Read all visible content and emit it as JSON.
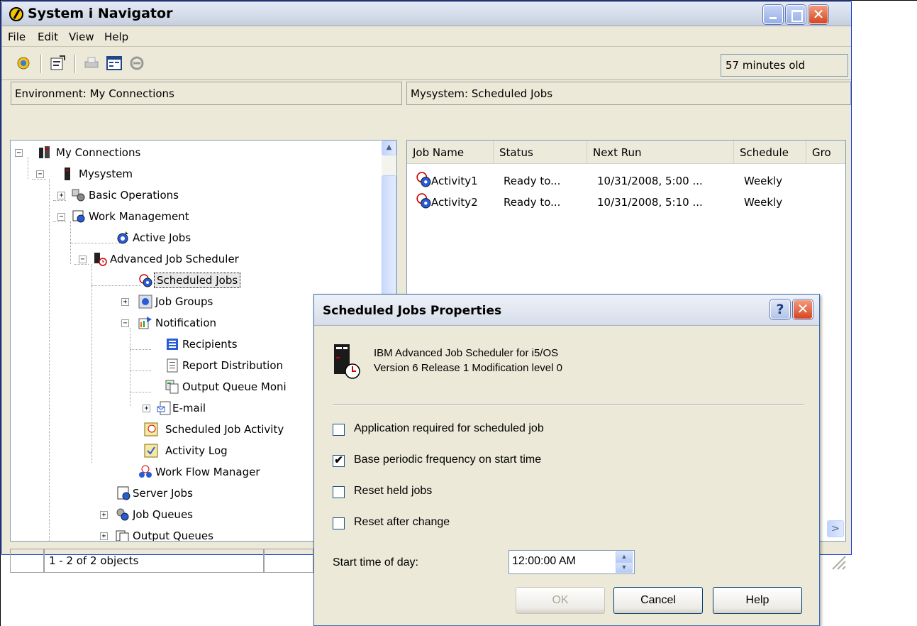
{
  "window": {
    "title": "System i Navigator",
    "menu": [
      "File",
      "Edit",
      "View",
      "Help"
    ],
    "age_label": "57 minutes old",
    "left_header": "Environment: My Connections",
    "right_header": "Mysystem:  Scheduled Jobs",
    "status": "1 - 2 of 2 objects"
  },
  "tree": [
    {
      "label": "My Connections",
      "icon": "connections-icon"
    },
    {
      "label": "Mysystem",
      "icon": "system-icon"
    },
    {
      "label": "Basic Operations",
      "icon": "basic-operations-icon"
    },
    {
      "label": "Work Management",
      "icon": "work-management-icon"
    },
    {
      "label": "Active Jobs",
      "icon": "active-jobs-icon"
    },
    {
      "label": "Advanced Job Scheduler",
      "icon": "job-scheduler-icon"
    },
    {
      "label": "Scheduled Jobs",
      "icon": "scheduled-jobs-icon",
      "selected": true
    },
    {
      "label": "Job Groups",
      "icon": "job-groups-icon"
    },
    {
      "label": "Notification",
      "icon": "notification-icon"
    },
    {
      "label": "Recipients",
      "icon": "recipients-icon"
    },
    {
      "label": "Report Distribution",
      "icon": "report-distribution-icon"
    },
    {
      "label": "Output Queue Moni",
      "icon": "output-queue-monitor-icon"
    },
    {
      "label": "E-mail",
      "icon": "email-icon"
    },
    {
      "label": "Scheduled Job Activity",
      "icon": "job-activity-icon"
    },
    {
      "label": "Activity Log",
      "icon": "activity-log-icon"
    },
    {
      "label": "Work Flow Manager",
      "icon": "work-flow-icon"
    },
    {
      "label": "Server Jobs",
      "icon": "server-jobs-icon"
    },
    {
      "label": "Job Queues",
      "icon": "job-queues-icon"
    },
    {
      "label": "Output Queues",
      "icon": "output-queues-icon"
    }
  ],
  "list": {
    "columns": [
      "Job Name",
      "Status",
      "Next Run",
      "Schedule",
      "Gro"
    ],
    "rows": [
      [
        "Activity1",
        "Ready to...",
        "10/31/2008, 5:00 ...",
        "Weekly"
      ],
      [
        "Activity2",
        "Ready to...",
        "10/31/2008, 5:10 ...",
        "Weekly"
      ]
    ]
  },
  "dialog": {
    "title": "Scheduled Jobs Properties",
    "help_glyph": "?",
    "product_line1": "IBM Advanced Job Scheduler for i5/OS",
    "product_line2": "Version 6 Release 1 Modification level 0",
    "options": [
      {
        "label": "Application required for scheduled job",
        "checked": false
      },
      {
        "label": "Base periodic frequency on start time",
        "checked": true
      },
      {
        "label": "Reset held jobs",
        "checked": false
      },
      {
        "label": "Reset after change",
        "checked": false
      }
    ],
    "start_time_label": "Start time of day:",
    "start_time_value": "12:00:00 AM",
    "buttons": {
      "ok": "OK",
      "cancel": "Cancel",
      "help": "Help"
    }
  }
}
